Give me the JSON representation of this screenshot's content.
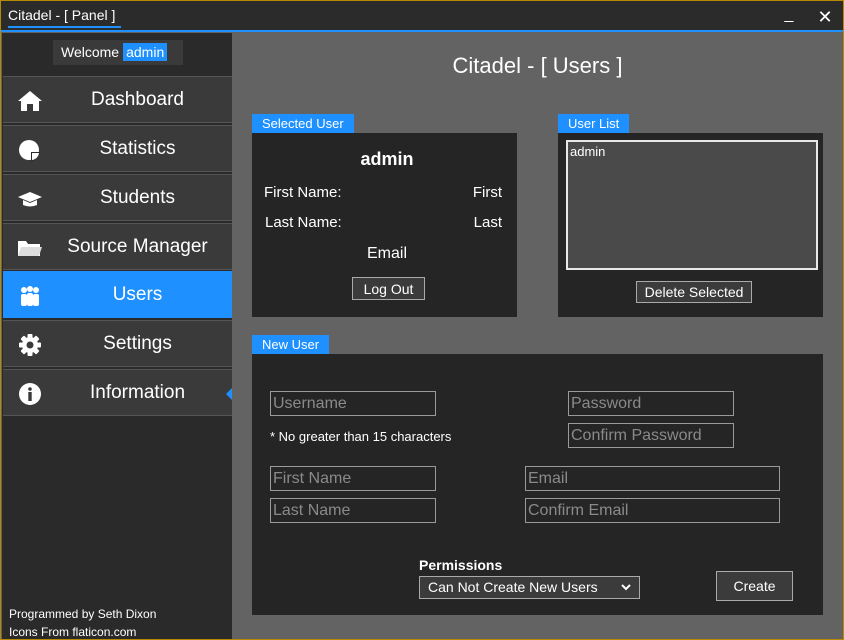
{
  "window": {
    "title": "Citadel - [ Panel ]",
    "minimize_glyph": "_",
    "close_glyph": "✕"
  },
  "sidebar": {
    "welcome_label": "Welcome",
    "welcome_user": "admin",
    "items": [
      {
        "label": "Dashboard",
        "icon": "home-icon"
      },
      {
        "label": "Statistics",
        "icon": "pie-chart-icon"
      },
      {
        "label": "Students",
        "icon": "graduation-cap-icon"
      },
      {
        "label": "Source Manager",
        "icon": "folder-icon"
      },
      {
        "label": "Users",
        "icon": "users-icon",
        "active": true
      },
      {
        "label": "Settings",
        "icon": "gear-icon"
      },
      {
        "label": "Information",
        "icon": "info-icon"
      }
    ],
    "credits_line1": "Programmed by Seth Dixon",
    "credits_line2": "Icons From flaticon.com"
  },
  "main": {
    "title": "Citadel - [ Users ]",
    "selected_user": {
      "tag": "Selected User",
      "name": "admin",
      "first_name_label": "First Name:",
      "first_name_value": "First",
      "last_name_label": "Last Name:",
      "last_name_value": "Last",
      "email_value": "Email",
      "logout_label": "Log Out"
    },
    "user_list": {
      "tag": "User List",
      "items": [
        "admin"
      ],
      "delete_label": "Delete Selected"
    },
    "new_user": {
      "tag": "New User",
      "username_placeholder": "Username",
      "password_placeholder": "Password",
      "confirm_password_placeholder": "Confirm Password",
      "hint": "* No greater than 15 characters",
      "first_name_placeholder": "First Name",
      "email_placeholder": "Email",
      "last_name_placeholder": "Last Name",
      "confirm_email_placeholder": "Confirm Email",
      "permissions_label": "Permissions",
      "permissions_selected": "Can Not Create New Users",
      "create_label": "Create"
    }
  },
  "colors": {
    "accent": "#1e90ff",
    "sidebar_bg": "#2a2a2a",
    "panel_bg": "#252525",
    "main_bg": "#636363"
  }
}
